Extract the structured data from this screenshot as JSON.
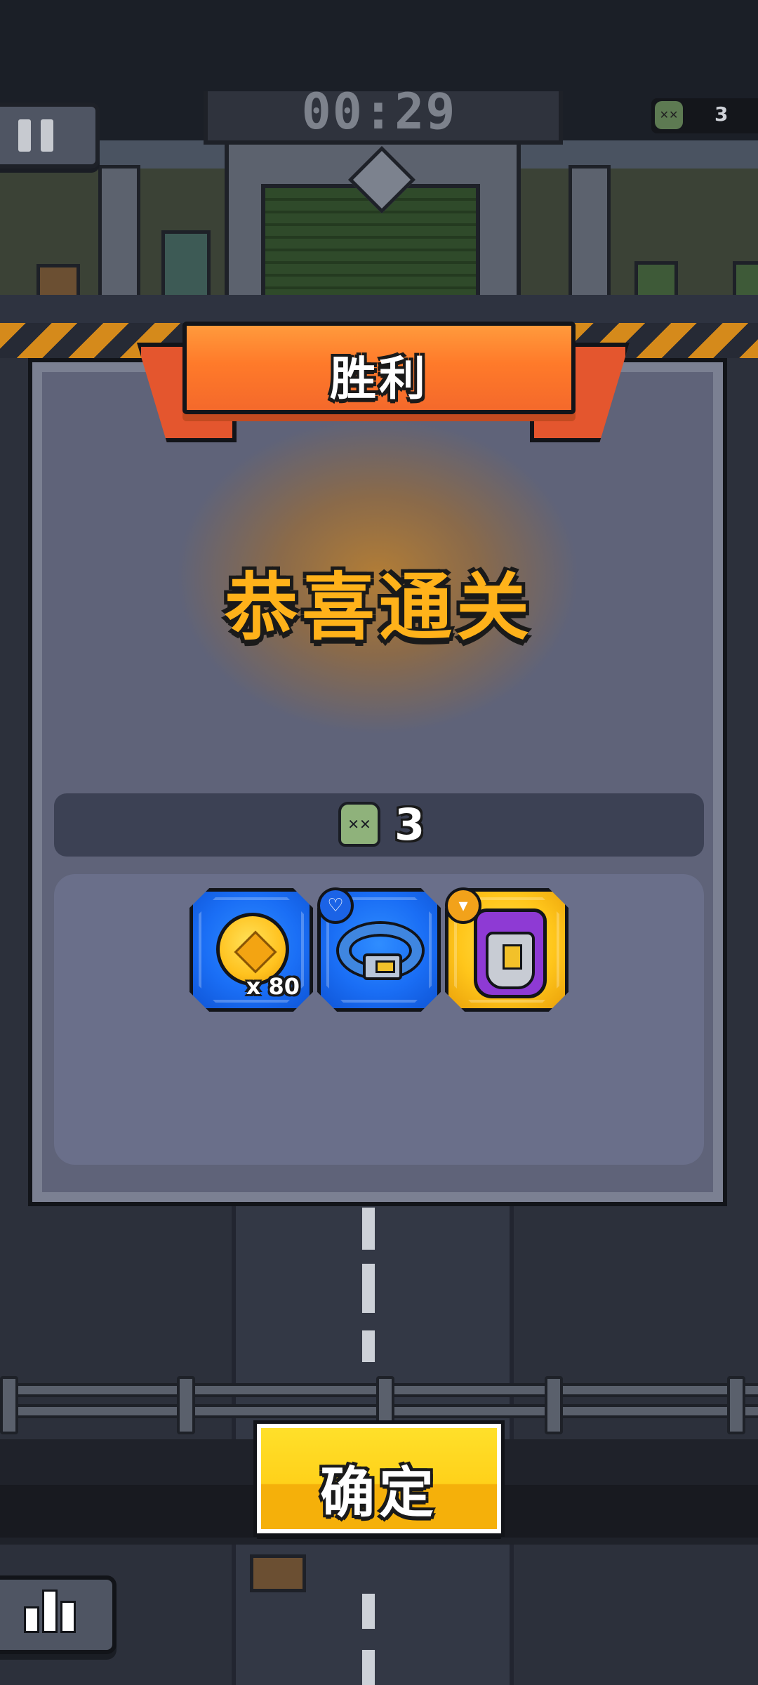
{
  "hud": {
    "timer": "00:29",
    "kill_counter": "3",
    "pause_icon": "pause-icon",
    "zombie_icon": "zombie-head-icon"
  },
  "dialog": {
    "title": "胜利",
    "headline": "恭喜通关",
    "kills": "3",
    "rewards": [
      {
        "name": "coin",
        "icon": "gold-coin-icon",
        "rarity_color": "#1a6ef5",
        "quantity": "x 80"
      },
      {
        "name": "belt",
        "icon": "belt-icon",
        "rarity_color": "#1a6ef5",
        "slot_badge_icon": "necklace-slot-icon"
      },
      {
        "name": "armor",
        "icon": "armor-vest-icon",
        "rarity_color": "#ffc61b",
        "slot_badge_icon": "shirt-slot-icon"
      }
    ]
  },
  "buttons": {
    "confirm": "确定",
    "stats_icon": "bar-chart-icon"
  },
  "colors": {
    "ribbon": "#ff7a2a",
    "headline": "#ffb21a",
    "confirm": "#ffd11a",
    "panel": "#6a6f8a"
  }
}
